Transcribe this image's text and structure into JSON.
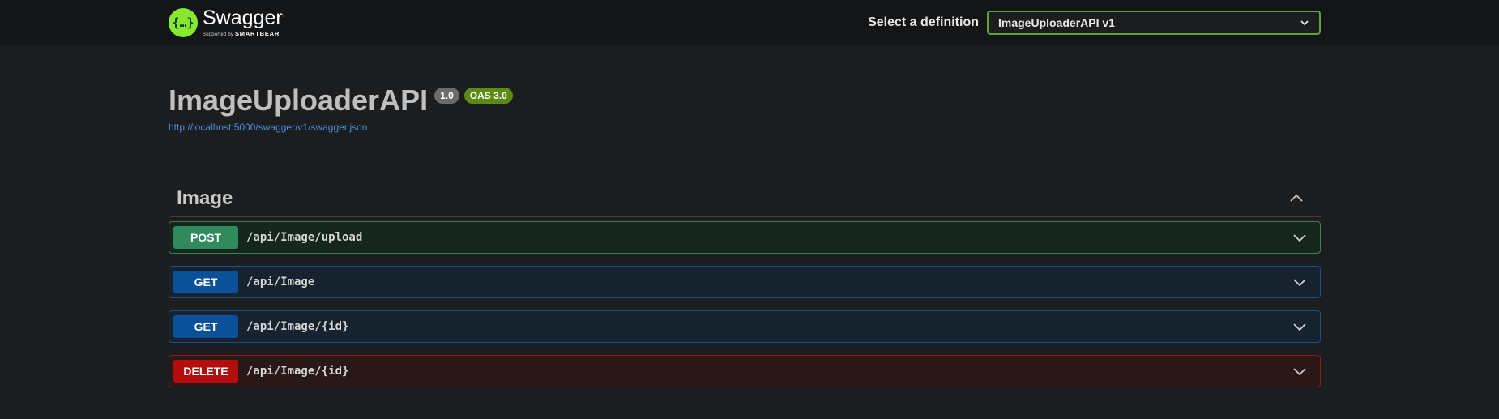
{
  "header": {
    "logo_title": "Swagger",
    "logo_mark": "{…}",
    "logo_supported": "Supported by",
    "logo_brand": "SMARTBEAR",
    "definition_label": "Select a definition",
    "definition_value": "ImageUploaderAPI v1"
  },
  "info": {
    "title": "ImageUploaderAPI",
    "version_badge": "1.0",
    "oas_badge": "OAS 3.0",
    "spec_url": "http://localhost:5000/swagger/v1/swagger.json"
  },
  "tag": {
    "name": "Image"
  },
  "operations": [
    {
      "method": "POST",
      "path": "/api/Image/upload"
    },
    {
      "method": "GET",
      "path": "/api/Image"
    },
    {
      "method": "GET",
      "path": "/api/Image/{id}"
    },
    {
      "method": "DELETE",
      "path": "/api/Image/{id}"
    }
  ],
  "colors": {
    "post": "#49cc90",
    "get": "#61affe",
    "delete": "#f93e3e",
    "brand": "#85ea2d"
  },
  "icons": [
    "swagger-logo-icon",
    "chevron-down-icon",
    "chevron-up-icon"
  ]
}
